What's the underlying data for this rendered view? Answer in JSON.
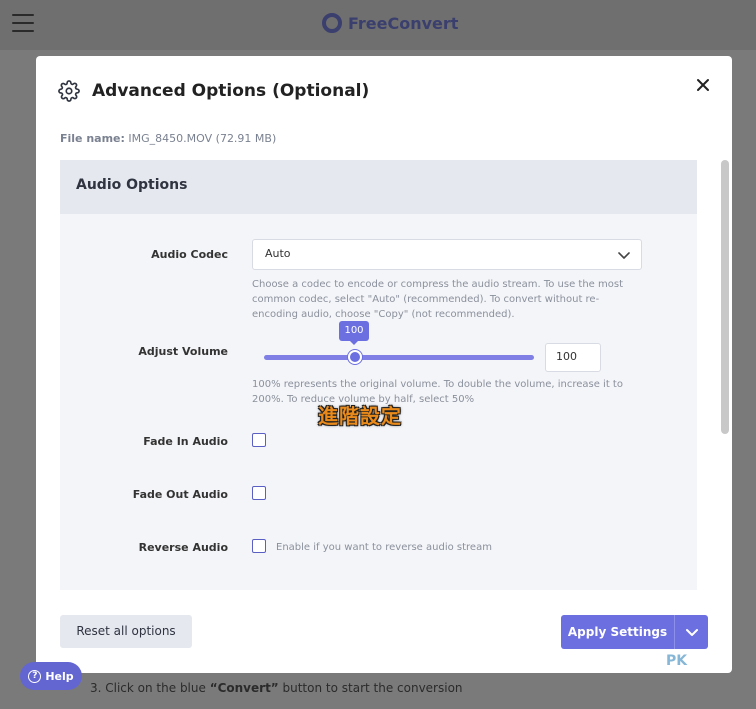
{
  "background": {
    "brand": "FreeConvert",
    "footer_step": "3. Click on the blue ",
    "footer_bold": "“Convert”",
    "footer_rest": " button to start the conversion",
    "help_label": "Help"
  },
  "modal": {
    "title": "Advanced Options (Optional)",
    "file_label": "File name:",
    "file_value": "IMG_8450.MOV (72.91 MB)",
    "section_title": "Audio Options",
    "audio_codec": {
      "label": "Audio Codec",
      "value": "Auto",
      "hint": "Choose a codec to encode or compress the audio stream. To use the most common codec, select \"Auto\" (recommended). To convert without re-encoding audio, choose \"Copy\" (not recommended)."
    },
    "adjust_volume": {
      "label": "Adjust Volume",
      "value": "100",
      "bubble": "100",
      "hint": "100% represents the original volume. To double the volume, increase it to 200%. To reduce volume by half, select 50%"
    },
    "fade_in": {
      "label": "Fade In Audio"
    },
    "fade_out": {
      "label": "Fade Out Audio"
    },
    "reverse": {
      "label": "Reverse Audio",
      "hint": "Enable if you want to reverse audio stream"
    },
    "overlay_caption": "進階設定",
    "reset_label": "Reset all options",
    "apply_label": "Apply Settings",
    "watermark": "PK"
  },
  "colors": {
    "accent": "#6c6fe0",
    "section_bg": "#e6e8f0",
    "overlay": "#e98a1b"
  }
}
